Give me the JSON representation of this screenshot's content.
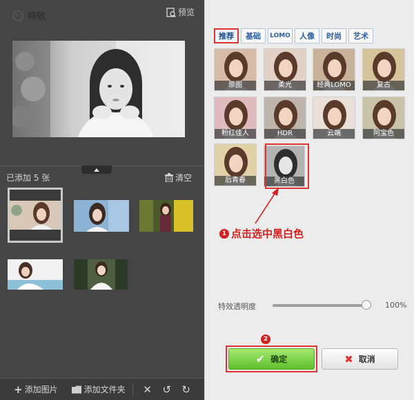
{
  "left_panel": {
    "preview_label": "预览",
    "added_count": "已添加 5 张",
    "clear_label": "清空",
    "thumbnails": [
      {
        "name": "photo-1"
      },
      {
        "name": "photo-2"
      },
      {
        "name": "photo-3"
      },
      {
        "name": "photo-4"
      },
      {
        "name": "photo-5"
      }
    ],
    "bottom_bar": {
      "add_image": "添加图片",
      "add_folder": "添加文件夹"
    }
  },
  "effects_panel": {
    "title": "特效",
    "tabs": [
      {
        "label": "推荐",
        "active": true
      },
      {
        "label": "基础",
        "active": false
      },
      {
        "label": "LOMO",
        "active": false
      },
      {
        "label": "人像",
        "active": false
      },
      {
        "label": "时尚",
        "active": false
      },
      {
        "label": "艺术",
        "active": false
      }
    ],
    "effects": [
      {
        "label": "原图",
        "tone": "#c9a58c"
      },
      {
        "label": "柔光",
        "tone": "#d8c2b4"
      },
      {
        "label": "经典LOMO",
        "tone": "#b89a7a"
      },
      {
        "label": "复古",
        "tone": "#c8b07c"
      },
      {
        "label": "粉红佳人",
        "tone": "#d4a4a8"
      },
      {
        "label": "HDR",
        "tone": "#a89c92"
      },
      {
        "label": "云端",
        "tone": "#e2d6cc"
      },
      {
        "label": "阿宝色",
        "tone": "#b7b08c"
      },
      {
        "label": "后青春",
        "tone": "#d6c28a"
      },
      {
        "label": "黑白色",
        "tone": "#9a9a9a",
        "selected": true
      }
    ],
    "annotation_1": {
      "number": "1",
      "text": "点击选中黑白色"
    },
    "annotation_2": {
      "number": "2"
    },
    "opacity": {
      "label": "特效透明度",
      "value": "100%",
      "level": 0.95
    },
    "confirm_label": "确定",
    "cancel_label": "取消"
  },
  "colors": {
    "accent_red": "#d33333",
    "confirm_green": "#6cc935",
    "tab_blue": "#2d5fa3"
  }
}
